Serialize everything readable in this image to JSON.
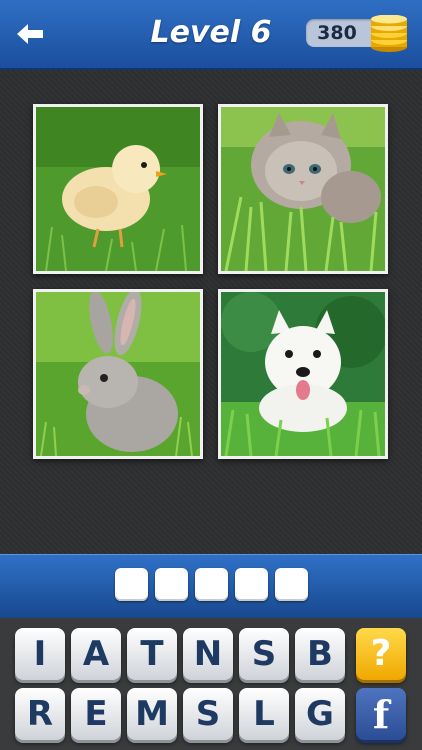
{
  "header": {
    "title": "Level 6",
    "coins": "380"
  },
  "icons": {
    "back": "back-arrow-icon",
    "coins": "coin-stack-icon",
    "hint": "question-mark-icon",
    "share": "facebook-icon"
  },
  "images": [
    {
      "subject": "chick"
    },
    {
      "subject": "kitten"
    },
    {
      "subject": "rabbit"
    },
    {
      "subject": "puppy"
    }
  ],
  "answer": {
    "slots": [
      "",
      "",
      "",
      "",
      ""
    ]
  },
  "keyboard": {
    "row1": [
      "I",
      "A",
      "T",
      "N",
      "S",
      "B"
    ],
    "row2": [
      "R",
      "E",
      "M",
      "S",
      "L",
      "G"
    ],
    "hint_label": "?",
    "share_label": "f"
  },
  "colors": {
    "bar_blue": "#2f6fc4",
    "hint_gold": "#f7c21e",
    "facebook_blue": "#3b5998"
  }
}
